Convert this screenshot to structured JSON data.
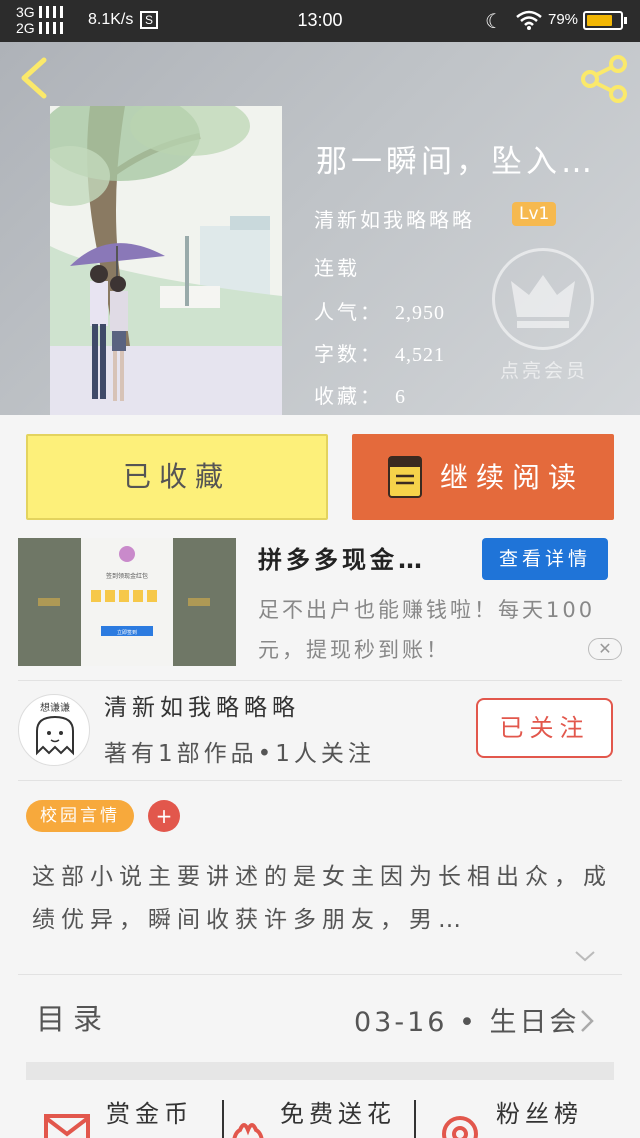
{
  "status_bar": {
    "network_top": "3G",
    "network_bottom": "2G",
    "speed": "8.1K/s",
    "sim_badge": "S",
    "time": "13:00",
    "battery_percent": "79%",
    "battery_level": 0.79
  },
  "book": {
    "title": "那一瞬间，坠入…",
    "author": "清新如我略略略",
    "level": "Lv1",
    "status": "连载",
    "popularity_label": "人气：",
    "popularity": "2,950",
    "word_count_label": "字数：",
    "word_count": "4,521",
    "favorites_label": "收藏：",
    "favorites": "6",
    "vip_label": "点亮会员"
  },
  "actions": {
    "collected_label": "已收藏",
    "continue_label": "继续阅读"
  },
  "ad": {
    "title": "拼多多现金…",
    "detail_button": "查看详情",
    "description": "足不出户也能赚钱啦！每天100元，提现秒到账！",
    "close": "✕",
    "mock_header": "签到领现金红包",
    "mock_button": "立即签到"
  },
  "author_card": {
    "avatar_text": "想谦谦",
    "name": "清新如我略略略",
    "stats": "著有1部作品•1人关注",
    "follow_label": "已关注"
  },
  "tags": {
    "primary": "校园言情",
    "add": "+"
  },
  "synopsis": "这部小说主要讲述的是女主因为长相出众，成绩优异，瞬间收获许多朋友，男…",
  "toc": {
    "label": "目录",
    "latest": "03-16 • 生日会"
  },
  "bottom": {
    "coins": "赏金币",
    "flowers": "免费送花",
    "fans": "粉丝榜"
  },
  "colors": {
    "accent_orange": "#e46a3c",
    "collected_yellow": "#fdf07a",
    "follow_red": "#e2574c",
    "tag_orange": "#f7a93c",
    "ad_blue": "#1f74d8"
  },
  "icons": [
    "back-arrow-icon",
    "share-icon",
    "crown-icon",
    "book-icon",
    "chevron-down-icon",
    "chevron-right-icon",
    "envelope-icon",
    "flower-icon",
    "target-icon",
    "wifi-icon",
    "moon-icon"
  ]
}
